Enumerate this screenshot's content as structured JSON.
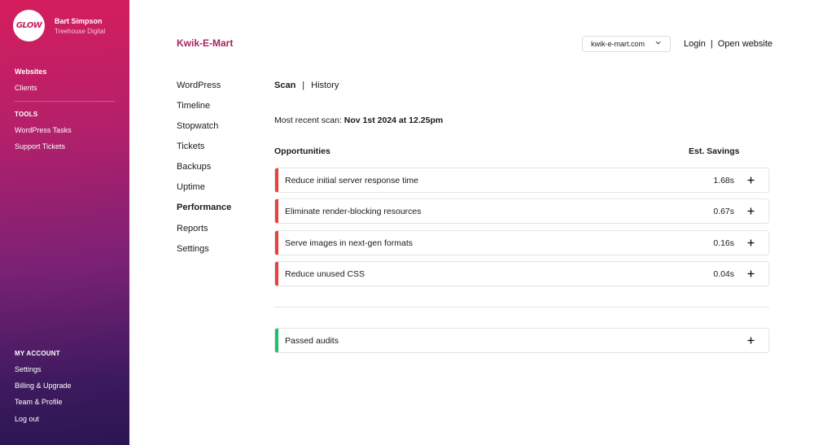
{
  "brand": {
    "logo_text": "GLOW"
  },
  "user": {
    "name": "Bart Simpson",
    "org": "Treehouse Digital"
  },
  "sidebar": {
    "primary": [
      {
        "label": "Websites"
      },
      {
        "label": "Clients"
      }
    ],
    "tools_heading": "TOOLS",
    "tools": [
      {
        "label": "WordPress Tasks"
      },
      {
        "label": "Support Tickets"
      }
    ],
    "account_heading": "MY ACCOUNT",
    "account": [
      {
        "label": "Settings"
      },
      {
        "label": "Billing & Upgrade"
      },
      {
        "label": "Team & Profile"
      },
      {
        "label": "Log out"
      }
    ]
  },
  "header": {
    "site_title": "Kwik-E-Mart",
    "site_select_value": "kwik-e-mart.com",
    "login_label": "Login",
    "separator": "|",
    "open_website_label": "Open website"
  },
  "subnav": [
    {
      "label": "WordPress"
    },
    {
      "label": "Timeline"
    },
    {
      "label": "Stopwatch"
    },
    {
      "label": "Tickets"
    },
    {
      "label": "Backups"
    },
    {
      "label": "Uptime"
    },
    {
      "label": "Performance"
    },
    {
      "label": "Reports"
    },
    {
      "label": "Settings"
    }
  ],
  "main": {
    "tabs": [
      {
        "label": "Scan"
      },
      {
        "label": "History"
      }
    ],
    "tab_separator": "|",
    "recent_scan_label": "Most recent scan:",
    "recent_scan_value": "Nov 1st 2024 at 12.25pm",
    "opportunities_heading": "Opportunities",
    "savings_heading": "Est. Savings",
    "opportunities": [
      {
        "label": "Reduce initial server response time",
        "value": "1.68s"
      },
      {
        "label": "Eliminate render-blocking resources",
        "value": "0.67s"
      },
      {
        "label": "Serve images in next-gen formats",
        "value": "0.16s"
      },
      {
        "label": "Reduce unused CSS",
        "value": "0.04s"
      }
    ],
    "passed_audits_label": "Passed audits"
  },
  "colors": {
    "accent": "#a8235e",
    "fail": "#ee3d3d",
    "pass": "#19c26b"
  }
}
